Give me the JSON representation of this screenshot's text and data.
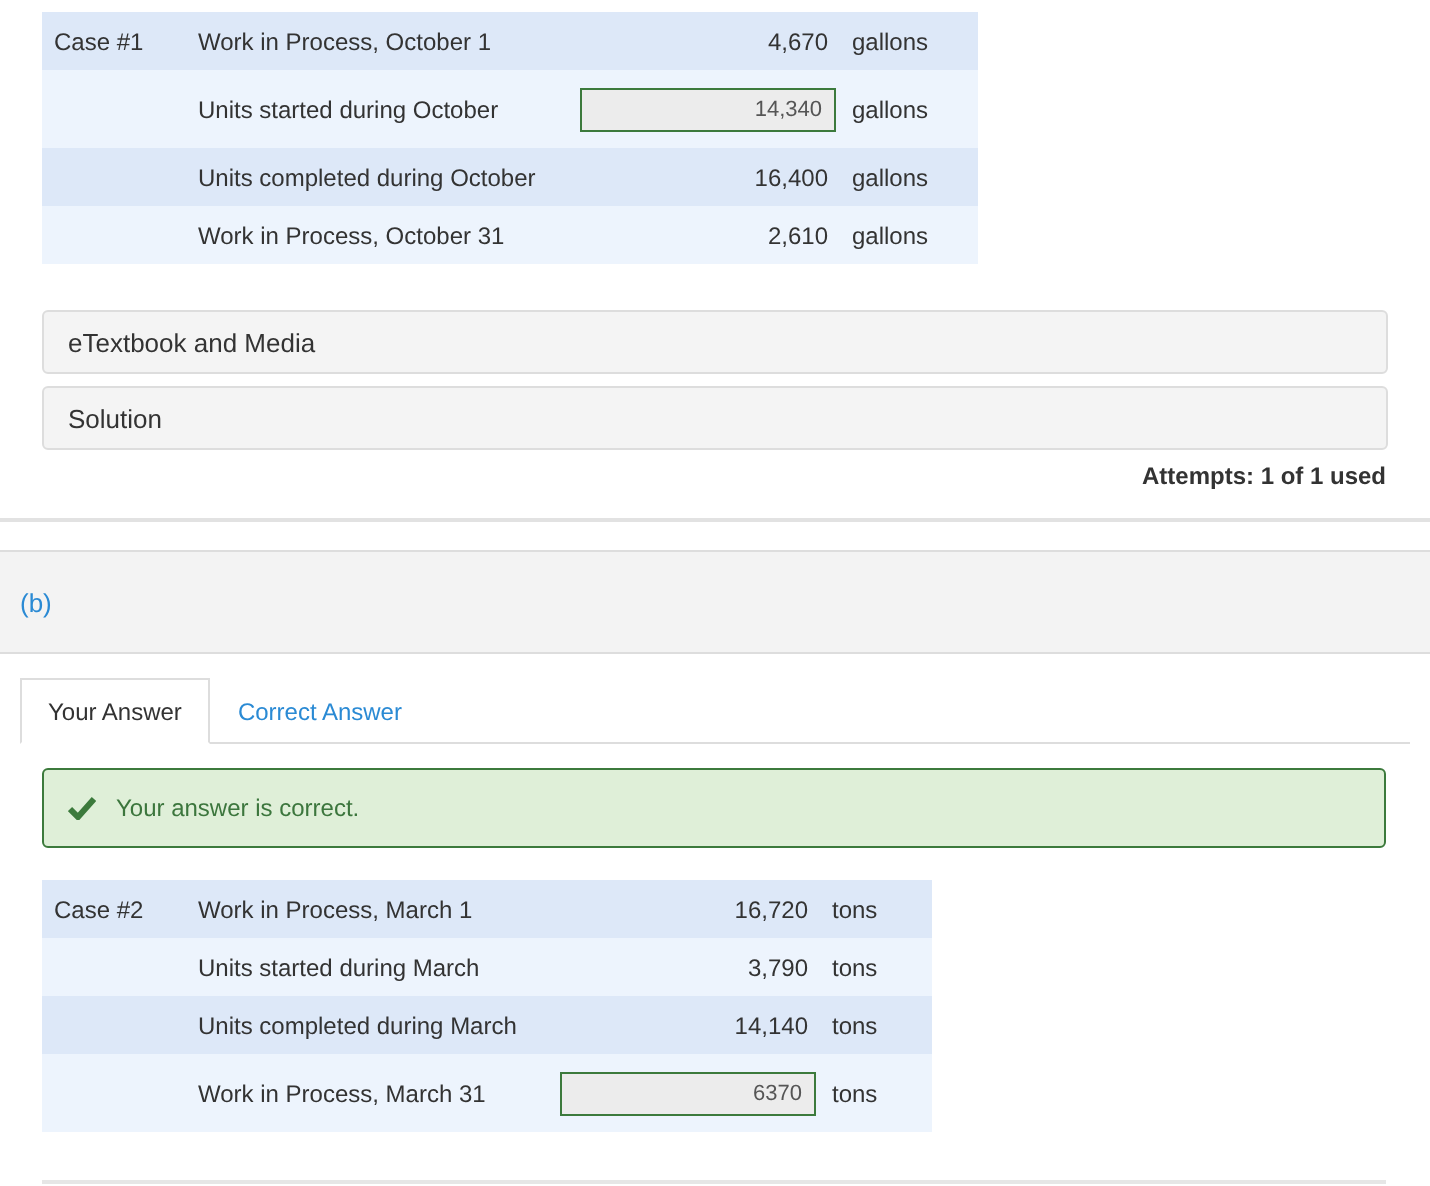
{
  "case_1": {
    "label": "Case #1",
    "rows": [
      {
        "kind": "value",
        "label": "Work in Process, October 1",
        "value": "4,670",
        "unit": "gallons"
      },
      {
        "kind": "input",
        "label": "Units started during October",
        "value": "14,340",
        "unit": "gallons"
      },
      {
        "kind": "value",
        "label": "Units completed during October",
        "value": "16,400",
        "unit": "gallons"
      },
      {
        "kind": "value",
        "label": "Work in Process, October 31",
        "value": "2,610",
        "unit": "gallons"
      }
    ]
  },
  "panels": [
    "eTextbook and Media",
    "Solution"
  ],
  "attempts": "Attempts: 1 of 1 used",
  "part": {
    "label": "(b)"
  },
  "tabs": [
    {
      "label": "Your Answer",
      "selected": true
    },
    {
      "label": "Correct Answer",
      "selected": false
    }
  ],
  "alert": {
    "text": "Your answer is correct."
  },
  "case_2": {
    "label": "Case #2",
    "rows": [
      {
        "kind": "value",
        "label": "Work in Process, March 1",
        "value": "16,720",
        "unit": "tons"
      },
      {
        "kind": "value",
        "label": "Units started during March",
        "value": "3,790",
        "unit": "tons"
      },
      {
        "kind": "value",
        "label": "Units completed during March",
        "value": "14,140",
        "unit": "tons"
      },
      {
        "kind": "input",
        "label": "Work in Process, March 31",
        "value": "6370",
        "unit": "tons"
      }
    ]
  }
}
